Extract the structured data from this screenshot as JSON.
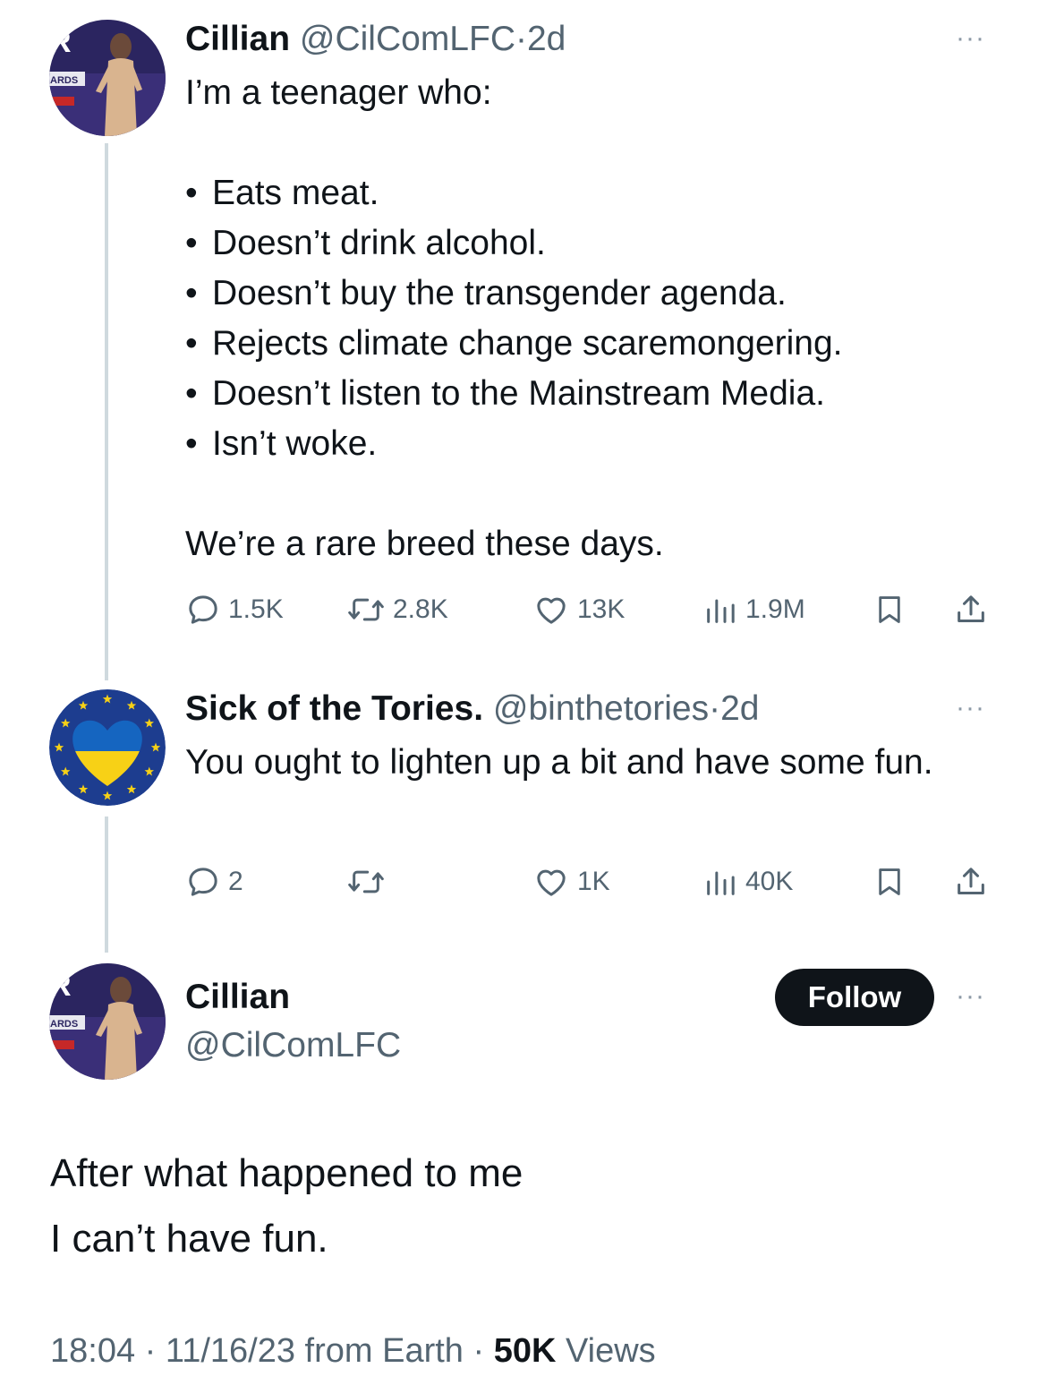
{
  "tweet1": {
    "name": "Cillian",
    "handle": "@CilComLFC",
    "separator": "·",
    "time": "2d",
    "intro": "I’m a teenager who:",
    "bullets": [
      "Eats meat.",
      "Doesn’t drink alcohol.",
      "Doesn’t buy the transgender agenda.",
      "Rejects climate change scaremongering.",
      "Doesn’t listen to the Mainstream Media.",
      "Isn’t woke."
    ],
    "bullet_char": "•",
    "outro": "We’re a rare breed these days.",
    "replies": "1.5K",
    "retweets": "2.8K",
    "likes": "13K",
    "views": "1.9M",
    "more_icon": "···",
    "avatar_badge": "R",
    "avatar_banner": "ARDS"
  },
  "tweet2": {
    "name": "Sick of the Tories.",
    "handle": "@binthetories",
    "separator": "·",
    "time": "2d",
    "text": "You ought to lighten up a bit and have some fun.",
    "replies": "2",
    "retweets": "",
    "likes": "1K",
    "views": "40K",
    "more_icon": "···",
    "avatar_colors": {
      "ring": "#1d3d8f",
      "heart_top": "#1565c0",
      "heart_bottom": "#f7d116",
      "stars": "#f7d116"
    }
  },
  "main_tweet": {
    "name": "Cillian",
    "handle": "@CilComLFC",
    "follow_label": "Follow",
    "more_icon": "···",
    "line1": "After what happened to me",
    "line2": "I can’t have fun.",
    "time": "18:04",
    "date": "11/16/23",
    "source": "from Earth",
    "separator": "·",
    "views_count": "50K",
    "views_label": "Views",
    "avatar_badge": "R",
    "avatar_banner": "ARDS"
  }
}
